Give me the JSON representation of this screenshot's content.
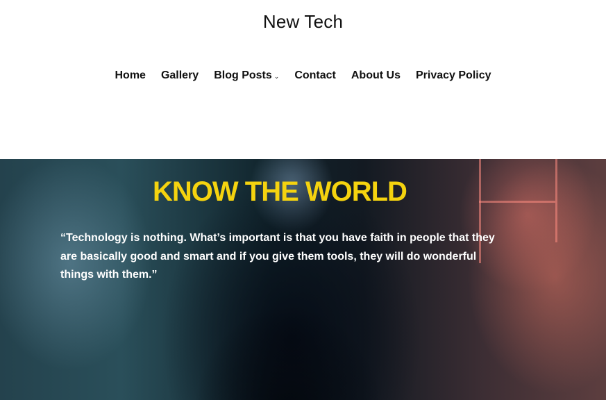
{
  "site": {
    "title": "New Tech"
  },
  "nav": {
    "items": [
      {
        "label": "Home"
      },
      {
        "label": "Gallery"
      },
      {
        "label": "Blog Posts",
        "has_submenu": true
      },
      {
        "label": "Contact"
      },
      {
        "label": "About Us"
      },
      {
        "label": "Privacy Policy"
      }
    ],
    "submenu_icon": "chevron-down-icon"
  },
  "hero": {
    "title": "KNOW THE WORLD",
    "quote": "“Technology is nothing. What’s important is that you have faith in people that they are basically good and smart and if you give them tools, they will do wonderful things with them.”"
  },
  "colors": {
    "accent": "#f5d30f",
    "text": "#111111",
    "background": "#ffffff"
  }
}
